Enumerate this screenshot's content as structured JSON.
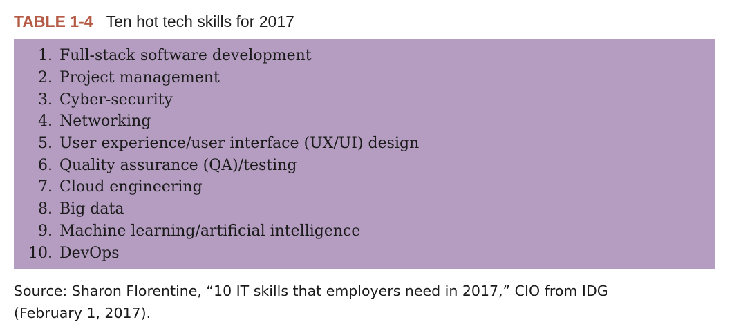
{
  "caption": {
    "tag": "TABLE 1-4",
    "title": "Ten hot tech skills for 2017"
  },
  "skills": [
    {
      "num": "1.",
      "text": "Full-stack software development"
    },
    {
      "num": "2.",
      "text": "Project management"
    },
    {
      "num": "3.",
      "text": "Cyber-security"
    },
    {
      "num": "4.",
      "text": "Networking"
    },
    {
      "num": "5.",
      "text": "User experience/user interface (UX/UI) design"
    },
    {
      "num": "6.",
      "text": "Quality assurance (QA)/testing"
    },
    {
      "num": "7.",
      "text": "Cloud engineering"
    },
    {
      "num": "8.",
      "text": "Big data"
    },
    {
      "num": "9.",
      "text": "Machine learning/artificial intelligence"
    },
    {
      "num": "10.",
      "text": "DevOps"
    }
  ],
  "source": {
    "line1": "Source: Sharon Florentine, “10 IT skills that employers need in 2017,” CIO from IDG",
    "line2": "(February 1, 2017)."
  },
  "colors": {
    "tag": "#b45a45",
    "panel": "#b49dc0"
  }
}
